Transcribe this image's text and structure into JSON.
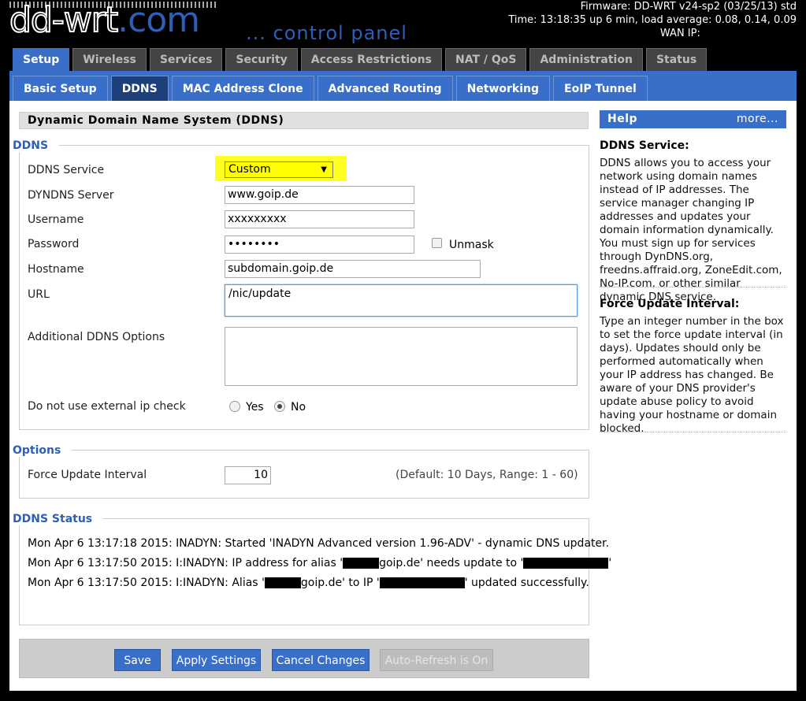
{
  "header": {
    "logo_main": "dd-wrt",
    "logo_domain": ".com",
    "subtitle": "... control panel",
    "firmware": "Firmware: DD-WRT v24-sp2 (03/25/13) std",
    "time": "Time: 13:18:35 up 6 min, load average: 0.08, 0.14, 0.09",
    "wan_ip_label": "WAN IP:"
  },
  "main_tabs": [
    "Setup",
    "Wireless",
    "Services",
    "Security",
    "Access Restrictions",
    "NAT / QoS",
    "Administration",
    "Status"
  ],
  "sub_tabs": [
    "Basic Setup",
    "DDNS",
    "MAC Address Clone",
    "Advanced Routing",
    "Networking",
    "EoIP Tunnel"
  ],
  "section_title": "Dynamic Domain Name System (DDNS)",
  "ddns": {
    "legend": "DDNS",
    "service_label": "DDNS Service",
    "service_value": "Custom",
    "server_label": "DYNDNS Server",
    "server_value": "www.goip.de",
    "username_label": "Username",
    "username_value": "xxxxxxxxx",
    "password_label": "Password",
    "password_value": "••••••••",
    "unmask_label": "Unmask",
    "hostname_label": "Hostname",
    "hostname_value": "subdomain.goip.de",
    "url_label": "URL",
    "url_value": "/nic/update",
    "additional_label": "Additional DDNS Options",
    "additional_value": "",
    "ext_ip_label": "Do not use external ip check",
    "yes_label": "Yes",
    "no_label": "No"
  },
  "options": {
    "legend": "Options",
    "force_label": "Force Update Interval",
    "force_value": "10",
    "force_hint": "(Default: 10 Days, Range: 1 - 60)"
  },
  "status": {
    "legend": "DDNS Status",
    "line1": "Mon Apr 6 13:17:18 2015: INADYN: Started 'INADYN Advanced version 1.96-ADV' - dynamic DNS updater.",
    "line2_a": "Mon Apr 6 13:17:50 2015: I:INADYN: IP address for alias '",
    "line2_b": "goip.de' needs update to '",
    "line2_c": "'",
    "line3_a": "Mon Apr 6 13:17:50 2015: I:INADYN: Alias '",
    "line3_b": "goip.de' to IP '",
    "line3_c": "' updated successfully."
  },
  "buttons": {
    "save": "Save",
    "apply": "Apply Settings",
    "cancel": "Cancel Changes",
    "autorefresh": "Auto-Refresh is On"
  },
  "help": {
    "title": "Help",
    "more": "more...",
    "ddns_title": "DDNS Service:",
    "ddns_text": "DDNS allows you to access your network using domain names instead of IP addresses. The service manager changing IP addresses and updates your domain information dynamically. You must sign up for services through DynDNS.org, freedns.affraid.org, ZoneEdit.com, No-IP.com, or other similar dynamic DNS service.",
    "force_title": "Force Update Interval:",
    "force_text": "Type an integer number in the box to set the force update interval (in days). Updates should only be performed automatically when your IP address has changed. Be aware of your DNS provider's update abuse policy to avoid having your hostname or domain blocked."
  },
  "colors": {
    "accent": "#3a6fc9",
    "highlight": "#ffff00",
    "legend": "#2e5fb8"
  }
}
